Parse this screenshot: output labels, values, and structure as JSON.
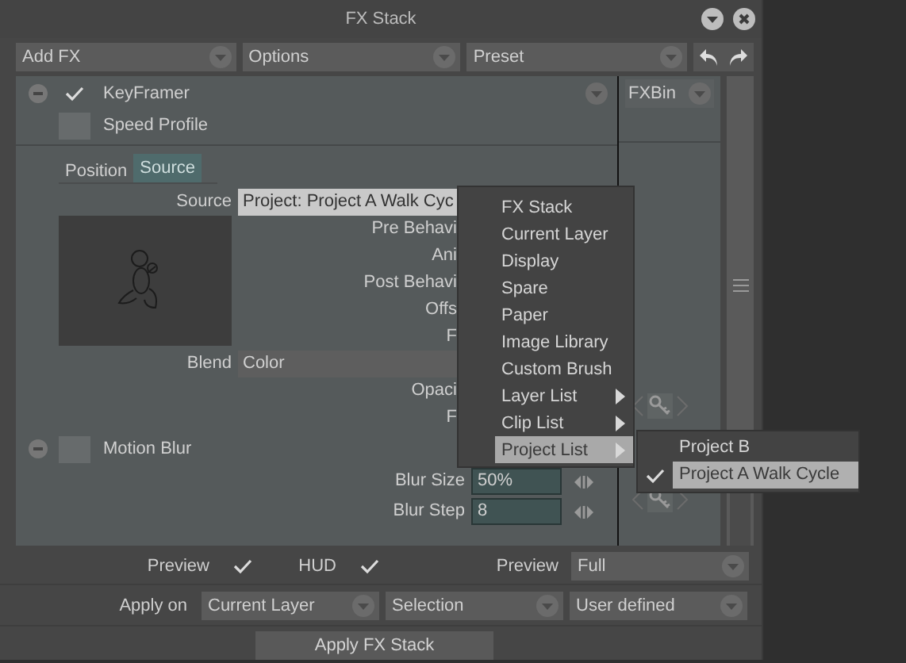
{
  "window": {
    "title": "FX Stack"
  },
  "toolbar": {
    "dropdowns": [
      {
        "label": "Add FX"
      },
      {
        "label": "Options"
      },
      {
        "label": "Preset"
      }
    ]
  },
  "effects": [
    {
      "kind": "keyframer",
      "name": "KeyFramer",
      "checked": true,
      "speed_profile": {
        "label": "Speed Profile",
        "checked": false
      },
      "tabs": [
        {
          "label": "Position",
          "selected": false
        },
        {
          "label": "Source",
          "selected": true
        }
      ],
      "source": {
        "label": "Source",
        "value": "Project: Project A Walk Cyc"
      },
      "properties": [
        "Pre Behavi",
        "Ani",
        "Post Behavi",
        "Offs",
        "F"
      ],
      "blend": {
        "label": "Blend",
        "value": "Color"
      },
      "more_properties": [
        "Opaci",
        "F"
      ]
    },
    {
      "kind": "blur",
      "name": "Motion Blur",
      "checked": false,
      "fields": [
        {
          "label": "Blur Size",
          "value": "50%"
        },
        {
          "label": "Blur Step",
          "value": "8"
        }
      ]
    }
  ],
  "fx_bin": {
    "title": "FXBin"
  },
  "options": {
    "preview": {
      "label": "Preview",
      "checked": true
    },
    "hud": {
      "label": "HUD",
      "checked": true
    },
    "preview_mode": {
      "label": "Preview",
      "value": "Full"
    }
  },
  "apply_on": {
    "label": "Apply on",
    "values": [
      "Current Layer",
      "Selection",
      "User defined"
    ]
  },
  "apply_button": "Apply FX Stack",
  "menu": {
    "items": [
      {
        "label": "FX Stack",
        "submenu": false,
        "selected": false
      },
      {
        "label": "Current Layer",
        "submenu": false,
        "selected": false
      },
      {
        "label": "Display",
        "submenu": false,
        "selected": false
      },
      {
        "label": "Spare",
        "submenu": false,
        "selected": false
      },
      {
        "label": "Paper",
        "submenu": false,
        "selected": false
      },
      {
        "label": "Image Library",
        "submenu": false,
        "selected": false
      },
      {
        "label": "Custom Brush",
        "submenu": false,
        "selected": false
      },
      {
        "label": "Layer List",
        "submenu": true,
        "selected": false
      },
      {
        "label": "Clip List",
        "submenu": true,
        "selected": false
      },
      {
        "label": "Project List",
        "submenu": true,
        "selected": true
      }
    ]
  },
  "submenu": {
    "items": [
      {
        "label": "Project B",
        "checked": false,
        "selected": false
      },
      {
        "label": "Project A Walk Cycle",
        "checked": true,
        "selected": true
      }
    ]
  }
}
